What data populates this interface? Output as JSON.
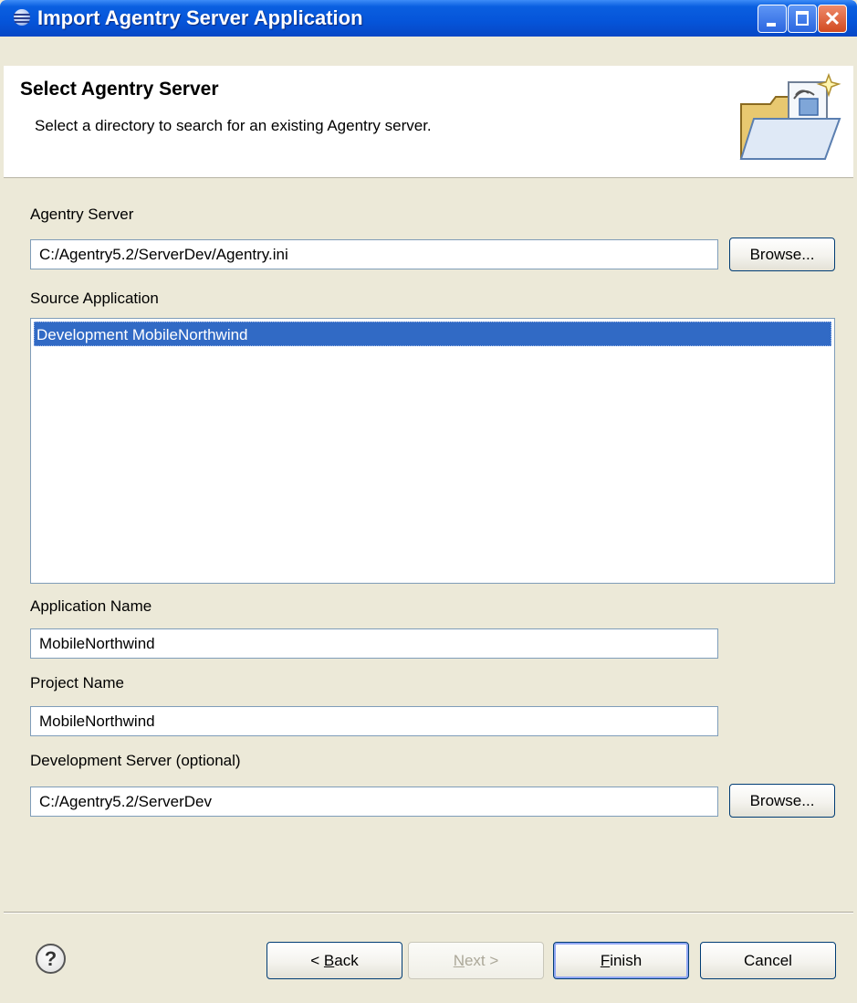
{
  "window": {
    "title": "Import Agentry Server Application",
    "controls": {
      "minimize": "_",
      "maximize": "□",
      "close": "✕"
    }
  },
  "header": {
    "title": "Select Agentry Server",
    "description": "Select a directory to search for an existing Agentry server."
  },
  "form": {
    "agentry_server": {
      "label": "Agentry Server",
      "value": "C:/Agentry5.2/ServerDev/Agentry.ini",
      "browse_label": "Browse..."
    },
    "source_application": {
      "label": "Source Application",
      "items": [
        "Development MobileNorthwind"
      ]
    },
    "application_name": {
      "label": "Application Name",
      "value": "MobileNorthwind"
    },
    "project_name": {
      "label": "Project Name",
      "value": "MobileNorthwind"
    },
    "development_server": {
      "label": "Development Server (optional)",
      "value": "C:/Agentry5.2/ServerDev",
      "browse_label": "Browse..."
    }
  },
  "footer": {
    "help": "?",
    "back": {
      "mnemonic": "B",
      "before": "< ",
      "after": "ack"
    },
    "next": {
      "mnemonic": "N",
      "before": "",
      "after": "ext >"
    },
    "finish": {
      "mnemonic": "F",
      "before": "",
      "after": "inish"
    },
    "cancel": "Cancel"
  },
  "colors": {
    "titlebar": "#0554D9",
    "dialog_bg": "#ECE9D8",
    "selection": "#316AC5",
    "close_button": "#D24A20"
  },
  "icons": [
    "app-icon",
    "minimize-icon",
    "maximize-icon",
    "close-icon",
    "import-folder-icon",
    "help-icon"
  ]
}
